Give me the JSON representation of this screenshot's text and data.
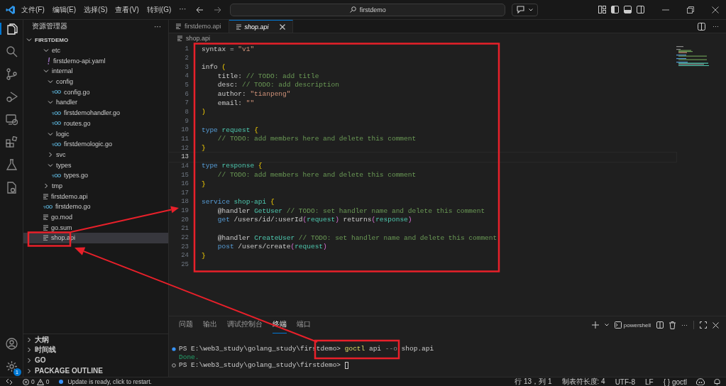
{
  "titlebar": {
    "menus": [
      "文件(F)",
      "编辑(E)",
      "选择(S)",
      "查看(V)",
      "转到(G)",
      "···"
    ],
    "search": "firstdemo"
  },
  "sidebar": {
    "title": "资源管理器",
    "more": "···",
    "root": {
      "label": "FIRSTDEMO",
      "expanded": true,
      "children": [
        {
          "label": "etc",
          "kind": "folder",
          "expanded": true,
          "selected": false,
          "children": [
            {
              "label": "firstdemo-api.yaml",
              "kind": "yaml",
              "selected": false
            }
          ]
        },
        {
          "label": "internal",
          "kind": "folder",
          "expanded": true,
          "selected": false,
          "children": [
            {
              "label": "config",
              "kind": "folder",
              "expanded": true,
              "selected": false,
              "children": [
                {
                  "label": "config.go",
                  "kind": "go",
                  "selected": false
                }
              ]
            },
            {
              "label": "handler",
              "kind": "folder",
              "expanded": true,
              "selected": false,
              "children": [
                {
                  "label": "firstdemohandler.go",
                  "kind": "go",
                  "selected": false
                },
                {
                  "label": "routes.go",
                  "kind": "go",
                  "selected": false
                }
              ]
            },
            {
              "label": "logic",
              "kind": "folder",
              "expanded": true,
              "selected": false,
              "children": [
                {
                  "label": "firstdemologic.go",
                  "kind": "go",
                  "selected": false
                }
              ]
            },
            {
              "label": "svc",
              "kind": "folder",
              "expanded": false,
              "selected": false
            },
            {
              "label": "types",
              "kind": "folder",
              "expanded": true,
              "selected": false,
              "children": [
                {
                  "label": "types.go",
                  "kind": "go",
                  "selected": false
                }
              ]
            }
          ]
        },
        {
          "label": "tmp",
          "kind": "folder",
          "expanded": false,
          "selected": false
        },
        {
          "label": "firstdemo.api",
          "kind": "text",
          "selected": false
        },
        {
          "label": "firstdemo.go",
          "kind": "go",
          "selected": false
        },
        {
          "label": "go.mod",
          "kind": "text",
          "selected": false
        },
        {
          "label": "go.sum",
          "kind": "text",
          "selected": false
        },
        {
          "label": "shop.api",
          "kind": "text",
          "selected": true
        }
      ]
    },
    "sections": [
      {
        "label": "大纲",
        "expanded": false
      },
      {
        "label": "时间线",
        "expanded": false
      },
      {
        "label": "GO",
        "expanded": false
      },
      {
        "label": "PACKAGE OUTLINE",
        "expanded": false
      }
    ]
  },
  "tabs": [
    {
      "label": "firstdemo.api",
      "selected": false
    },
    {
      "label": "shop.api",
      "selected": true
    }
  ],
  "breadcrumb": "shop.api",
  "code": [
    {
      "n": "1",
      "current": false,
      "tokens": [
        {
          "kind": "plain",
          "text": "syntax = "
        },
        {
          "kind": "string",
          "text": "\"v1\""
        }
      ]
    },
    {
      "n": "2",
      "current": false
    },
    {
      "n": "3",
      "current": false,
      "tokens": [
        {
          "kind": "plain",
          "text": "info "
        },
        {
          "kind": "brace",
          "text": "("
        }
      ]
    },
    {
      "n": "4",
      "current": false,
      "tokens": [
        {
          "kind": "plain",
          "text": "    title: "
        },
        {
          "kind": "comment",
          "text": "// TODO: add title"
        }
      ]
    },
    {
      "n": "5",
      "current": false,
      "tokens": [
        {
          "kind": "plain",
          "text": "    desc: "
        },
        {
          "kind": "comment",
          "text": "// TODO: add description"
        }
      ]
    },
    {
      "n": "6",
      "current": false,
      "tokens": [
        {
          "kind": "plain",
          "text": "    author: "
        },
        {
          "kind": "string",
          "text": "\"tianpeng\""
        }
      ]
    },
    {
      "n": "7",
      "current": false,
      "tokens": [
        {
          "kind": "plain",
          "text": "    email: "
        },
        {
          "kind": "string",
          "text": "\"\""
        }
      ]
    },
    {
      "n": "8",
      "current": false,
      "tokens": [
        {
          "kind": "brace",
          "text": ")"
        }
      ]
    },
    {
      "n": "9",
      "current": false
    },
    {
      "n": "10",
      "current": false,
      "tokens": [
        {
          "kind": "keyword",
          "text": "type "
        },
        {
          "kind": "name",
          "text": "request "
        },
        {
          "kind": "brace",
          "text": "{"
        }
      ]
    },
    {
      "n": "11",
      "current": false,
      "tokens": [
        {
          "kind": "comment",
          "text": "    // TODO: add members here and delete this comment"
        }
      ]
    },
    {
      "n": "12",
      "current": false,
      "tokens": [
        {
          "kind": "brace",
          "text": "}"
        }
      ]
    },
    {
      "n": "13",
      "current": true
    },
    {
      "n": "14",
      "current": false,
      "tokens": [
        {
          "kind": "keyword",
          "text": "type "
        },
        {
          "kind": "name",
          "text": "response "
        },
        {
          "kind": "brace",
          "text": "{"
        }
      ]
    },
    {
      "n": "15",
      "current": false,
      "tokens": [
        {
          "kind": "comment",
          "text": "    // TODO: add members here and delete this comment"
        }
      ]
    },
    {
      "n": "16",
      "current": false,
      "tokens": [
        {
          "kind": "brace",
          "text": "}"
        }
      ]
    },
    {
      "n": "17",
      "current": false
    },
    {
      "n": "18",
      "current": false,
      "tokens": [
        {
          "kind": "keyword",
          "text": "service "
        },
        {
          "kind": "name",
          "text": "shop-api "
        },
        {
          "kind": "brace",
          "text": "{"
        }
      ]
    },
    {
      "n": "19",
      "current": false,
      "tokens": [
        {
          "kind": "plain",
          "text": "    @handler "
        },
        {
          "kind": "name",
          "text": "GetUser "
        },
        {
          "kind": "comment",
          "text": "// TODO: set handler name and delete this comment"
        }
      ]
    },
    {
      "n": "20",
      "current": false,
      "tokens": [
        {
          "kind": "keyword",
          "text": "    get "
        },
        {
          "kind": "plain",
          "text": "/users/id/:userId"
        },
        {
          "kind": "paren",
          "text": "("
        },
        {
          "kind": "name",
          "text": "request"
        },
        {
          "kind": "paren",
          "text": ")"
        },
        {
          "kind": "plain",
          "text": " returns"
        },
        {
          "kind": "paren",
          "text": "("
        },
        {
          "kind": "name",
          "text": "response"
        },
        {
          "kind": "paren",
          "text": ")"
        }
      ]
    },
    {
      "n": "21",
      "current": false
    },
    {
      "n": "22",
      "current": false,
      "tokens": [
        {
          "kind": "plain",
          "text": "    @handler "
        },
        {
          "kind": "name",
          "text": "CreateUser "
        },
        {
          "kind": "comment",
          "text": "// TODO: set handler name and delete this comment"
        }
      ]
    },
    {
      "n": "23",
      "current": false,
      "tokens": [
        {
          "kind": "keyword",
          "text": "    post "
        },
        {
          "kind": "plain",
          "text": "/users/create"
        },
        {
          "kind": "paren",
          "text": "("
        },
        {
          "kind": "name",
          "text": "request"
        },
        {
          "kind": "paren",
          "text": ")"
        }
      ]
    },
    {
      "n": "24",
      "current": false,
      "tokens": [
        {
          "kind": "brace",
          "text": "}"
        }
      ]
    },
    {
      "n": "25",
      "current": false
    }
  ],
  "panel": {
    "tabs": [
      {
        "label": "问题",
        "selected": false
      },
      {
        "label": "输出",
        "selected": false
      },
      {
        "label": "调试控制台",
        "selected": false
      },
      {
        "label": "终端",
        "selected": true
      },
      {
        "label": "端口",
        "selected": false
      }
    ],
    "shell": "powershell",
    "terminal": [
      {
        "kind": "done",
        "tokens": [
          {
            "kind": "plain",
            "text": "PS E:\\web3_study\\golang_study\\firstdemo> "
          },
          {
            "kind": "command",
            "text": "goctl"
          },
          {
            "kind": "plain",
            "text": " api "
          },
          {
            "kind": "flag",
            "text": "--o"
          },
          {
            "kind": "plain",
            "text": " shop.api"
          }
        ]
      },
      {
        "kind": "output",
        "tokens": [
          {
            "kind": "success",
            "text": "Done."
          }
        ]
      },
      {
        "kind": "idle",
        "cursor": true,
        "tokens": [
          {
            "kind": "plain",
            "text": "PS E:\\web3_study\\golang_study\\firstdemo> "
          }
        ]
      }
    ]
  },
  "settings_badge": "1",
  "status_bar": {
    "errors": "0",
    "warnings": "0",
    "notice": "Update is ready, click to restart.",
    "items": [
      "行 13，列 1",
      "制表符长度: 4",
      "UTF-8",
      "LF"
    ],
    "language_icon": "{ }",
    "language": "goctl"
  }
}
